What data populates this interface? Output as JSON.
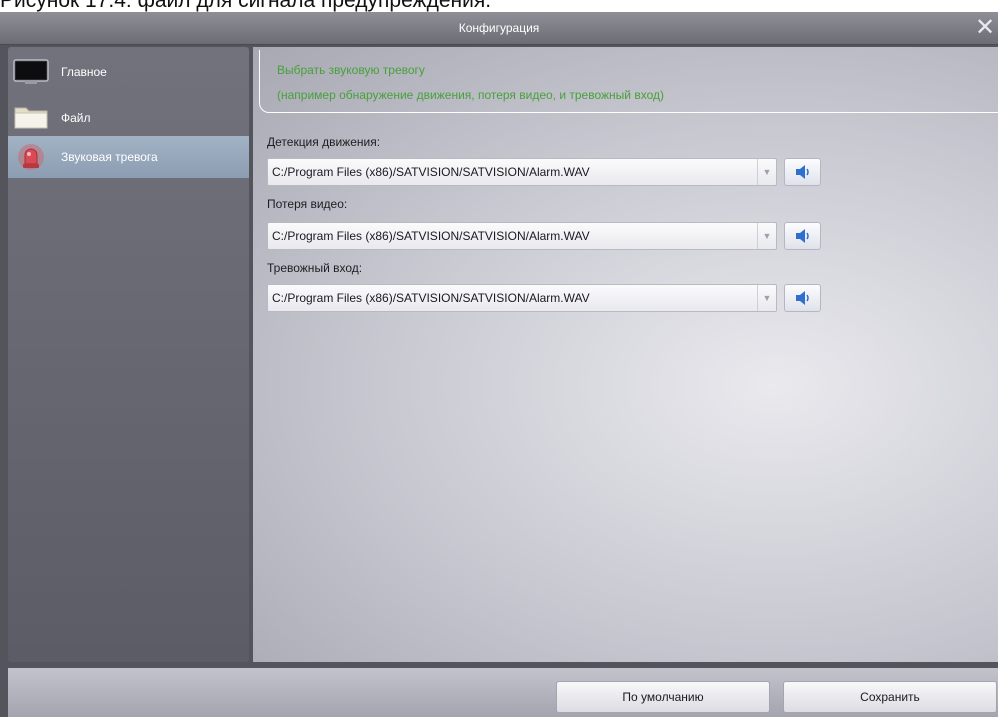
{
  "page_caption": "Рисунок 17.4: файл для сигнала предупреждения.",
  "window": {
    "title": "Конфигурация"
  },
  "sidebar": {
    "items": [
      {
        "label": "Главное",
        "icon": "monitor-icon"
      },
      {
        "label": "Файл",
        "icon": "folder-icon"
      },
      {
        "label": "Звуковая тревога",
        "icon": "alarm-icon",
        "active": true
      }
    ]
  },
  "main": {
    "header": {
      "line1": "Выбрать звуковую тревогу",
      "line2": "(например обнаружение движения, потеря видео, и тревожный вход)"
    },
    "fields": [
      {
        "label": "Детекция движения:",
        "value": "C:/Program Files (x86)/SATVISION/SATVISION/Alarm.WAV"
      },
      {
        "label": "Потеря видео:",
        "value": "C:/Program Files (x86)/SATVISION/SATVISION/Alarm.WAV"
      },
      {
        "label": "Тревожный вход:",
        "value": "C:/Program Files (x86)/SATVISION/SATVISION/Alarm.WAV"
      }
    ]
  },
  "footer": {
    "default_label": "По умолчанию",
    "save_label": "Сохранить"
  },
  "colors": {
    "header_text": "#47a03a",
    "active_item": "#97a7bb",
    "sidebar": "#6a6a74"
  }
}
